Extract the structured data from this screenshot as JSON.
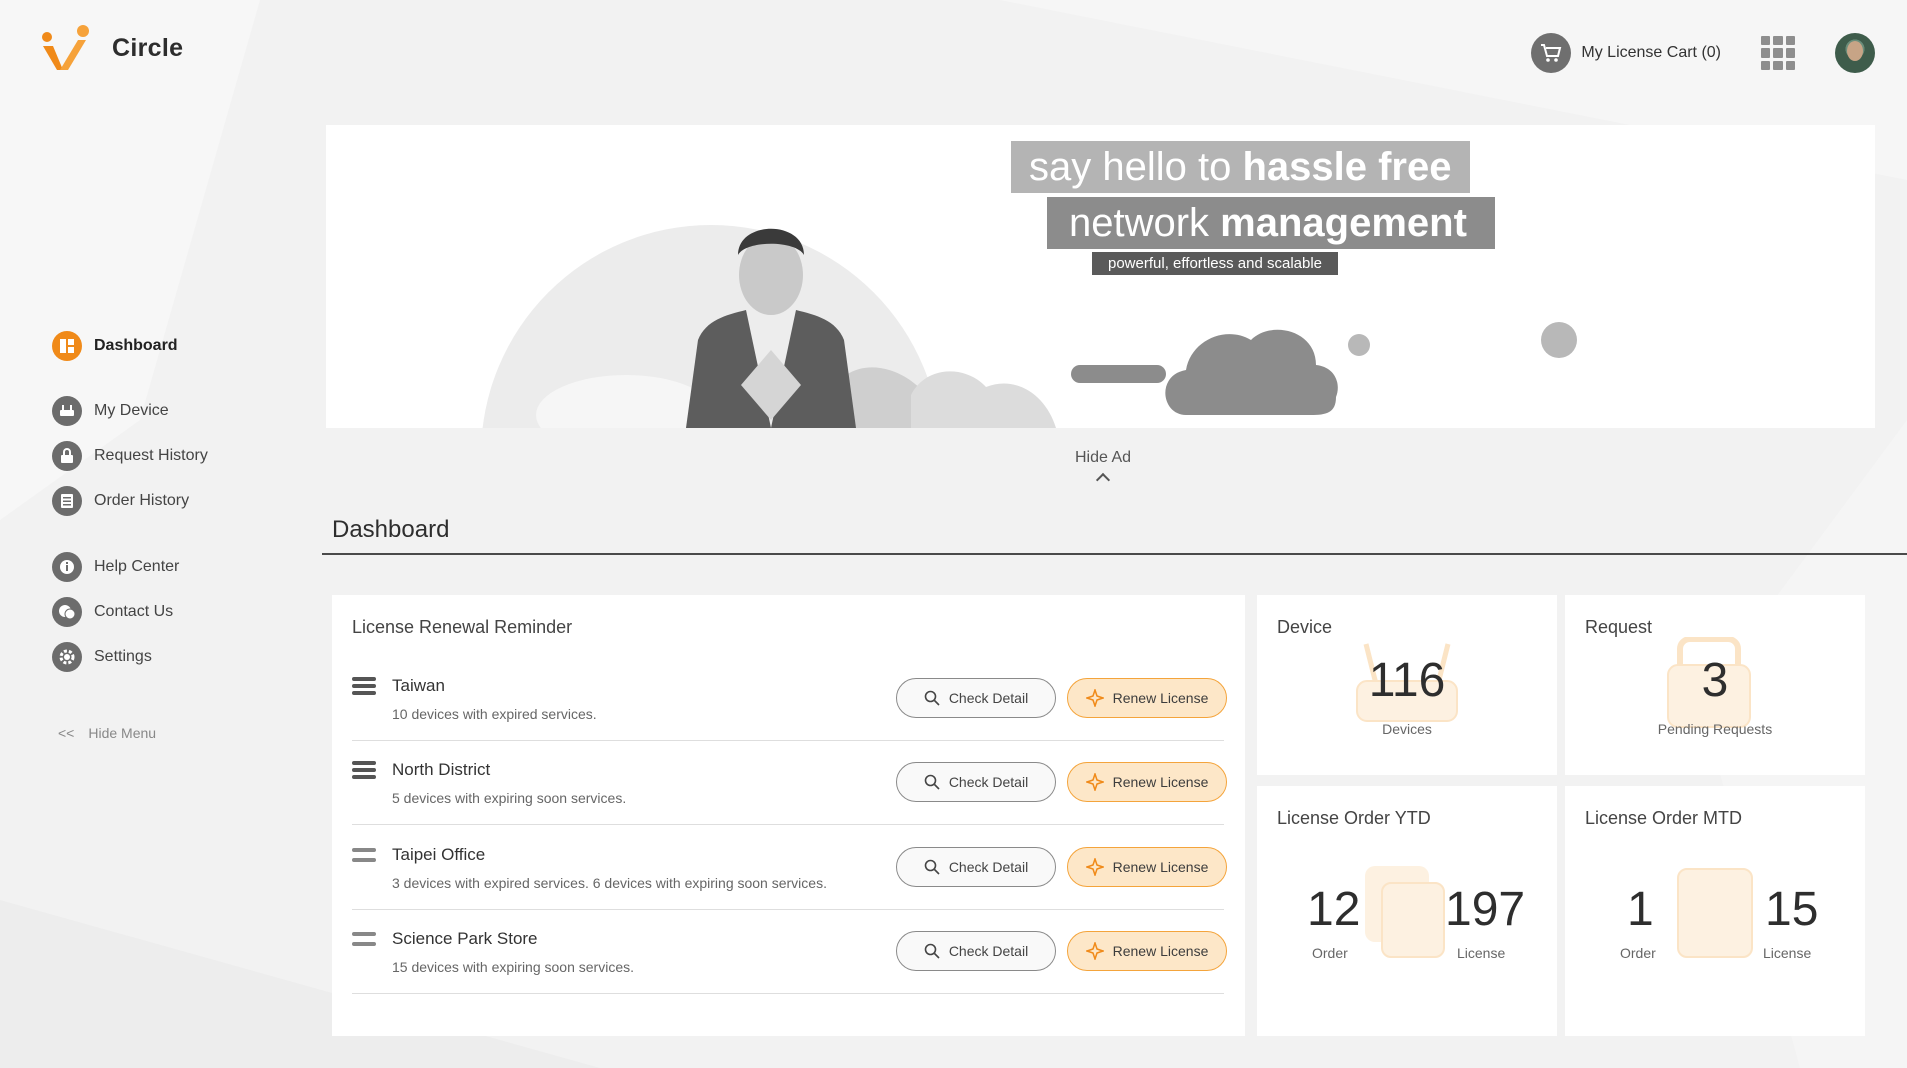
{
  "app": {
    "name": "Circle"
  },
  "header": {
    "cart_label": "My License Cart (0)"
  },
  "sidebar": {
    "items": [
      {
        "label": "Dashboard",
        "icon": "dashboard-icon",
        "active": true
      },
      {
        "label": "My Device",
        "icon": "device-icon"
      },
      {
        "label": "Request History",
        "icon": "lock-icon"
      },
      {
        "label": "Order History",
        "icon": "list-icon"
      },
      {
        "label": "Help Center",
        "icon": "info-icon"
      },
      {
        "label": "Contact Us",
        "icon": "chat-icon"
      },
      {
        "label": "Settings",
        "icon": "gear-icon"
      }
    ],
    "hide_menu_label": "Hide Menu",
    "hide_menu_glyph": "<<"
  },
  "banner": {
    "line1_light": "say hello to ",
    "line1_bold": "hassle free",
    "line2_light": "network ",
    "line2_bold": "management",
    "tagline": "powerful, effortless and scalable"
  },
  "hide_ad_label": "Hide Ad",
  "page_title": "Dashboard",
  "reminder": {
    "title": "License Renewal Reminder",
    "check_label": "Check Detail",
    "renew_label": "Renew License",
    "rows": [
      {
        "name": "Taiwan",
        "desc": "10 devices with expired services."
      },
      {
        "name": "North District",
        "desc": "5 devices with expiring soon services."
      },
      {
        "name": "Taipei Office",
        "desc": "3 devices with expired services. 6 devices with expiring soon services."
      },
      {
        "name": "Science Park Store",
        "desc": "15 devices with expiring soon services."
      }
    ]
  },
  "device_card": {
    "title": "Device",
    "value": "116",
    "label": "Devices"
  },
  "request_card": {
    "title": "Request",
    "value": "3",
    "label": "Pending Requests"
  },
  "ytd_card": {
    "title": "License Order YTD",
    "order_value": "12",
    "order_label": "Order",
    "license_value": "197",
    "license_label": "License"
  },
  "mtd_card": {
    "title": "License Order MTD",
    "order_value": "1",
    "order_label": "Order",
    "license_value": "15",
    "license_label": "License"
  },
  "colors": {
    "accent": "#f08a19",
    "accent_light": "#fde7c8",
    "bg": "#f2f2f2"
  }
}
